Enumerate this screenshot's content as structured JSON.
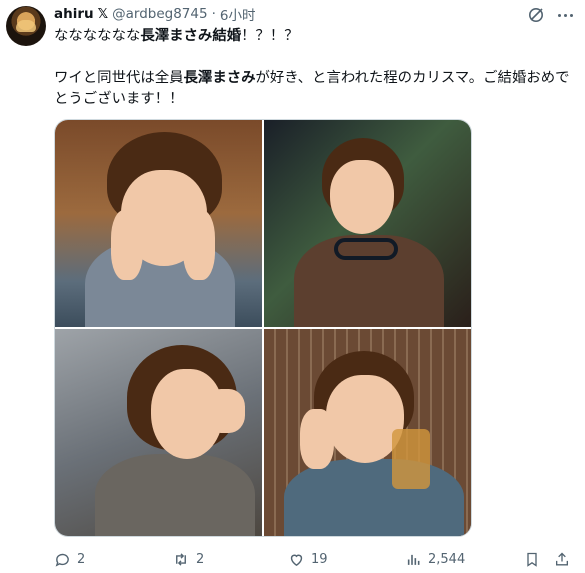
{
  "author": {
    "name": "ahiru",
    "verified_mark": "𝕏",
    "handle": "@ardbeg8745",
    "separator": "·",
    "time": "6小时"
  },
  "post": {
    "line1_prefix": "なななななな",
    "line1_bold": "長澤まさみ結婚",
    "line1_suffix": "！？！？",
    "para_prefix": "ワイと同世代は全員",
    "para_bold": "長澤まさみ",
    "para_suffix": "が好き、と言われた程のカリスマ。ご結婚おめでとうございます！！"
  },
  "icons": [
    "grok-icon",
    "more-icon",
    "reply-icon",
    "repost-icon",
    "like-icon",
    "views-icon",
    "bookmark-icon",
    "share-icon"
  ],
  "actions": {
    "replies": "2",
    "reposts": "2",
    "likes": "19",
    "views": "2,544"
  },
  "colors": {
    "text": "#0f1419",
    "secondary": "#536471",
    "border": "#cfd9de"
  }
}
